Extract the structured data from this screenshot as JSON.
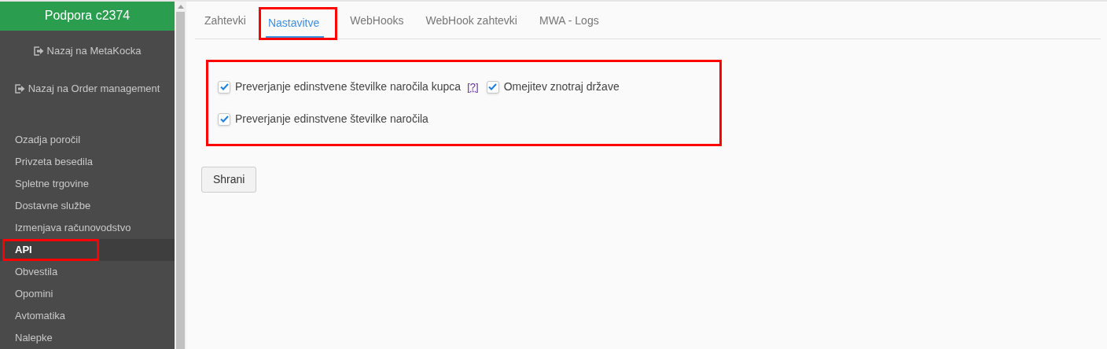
{
  "sidebar": {
    "title": "Podpora c2374",
    "links": [
      {
        "label": "Nazaj na MetaKocka"
      },
      {
        "label": "Nazaj na Order management"
      }
    ],
    "items": [
      {
        "label": "Ozadja poročil",
        "selected": false,
        "highlighted": false
      },
      {
        "label": "Privzeta besedila",
        "selected": false,
        "highlighted": false
      },
      {
        "label": "Spletne trgovine",
        "selected": false,
        "highlighted": false
      },
      {
        "label": "Dostavne službe",
        "selected": false,
        "highlighted": false
      },
      {
        "label": "Izmenjava računovodstvo",
        "selected": false,
        "highlighted": false
      },
      {
        "label": "API",
        "selected": true,
        "highlighted": true
      },
      {
        "label": "Obvestila",
        "selected": false,
        "highlighted": false
      },
      {
        "label": "Opomini",
        "selected": false,
        "highlighted": false
      },
      {
        "label": "Avtomatika",
        "selected": false,
        "highlighted": false
      },
      {
        "label": "Nalepke",
        "selected": false,
        "highlighted": false
      }
    ]
  },
  "tabs": [
    {
      "label": "Zahtevki",
      "selected": false,
      "highlighted": false
    },
    {
      "label": "Nastavitve",
      "selected": true,
      "highlighted": true
    },
    {
      "label": "WebHooks",
      "selected": false,
      "highlighted": false
    },
    {
      "label": "WebHook zahtevki",
      "selected": false,
      "highlighted": false
    },
    {
      "label": "MWA - Logs",
      "selected": false,
      "highlighted": false
    }
  ],
  "settings": {
    "highlighted": true,
    "rows": [
      [
        {
          "label": "Preverjanje edinstvene številke naročila kupca",
          "checked": true,
          "help": "[?]"
        },
        {
          "label": "Omejitev znotraj države",
          "checked": true
        }
      ],
      [
        {
          "label": "Preverjanje edinstvene številke naročila",
          "checked": true
        }
      ]
    ]
  },
  "save_button": "Shrani"
}
